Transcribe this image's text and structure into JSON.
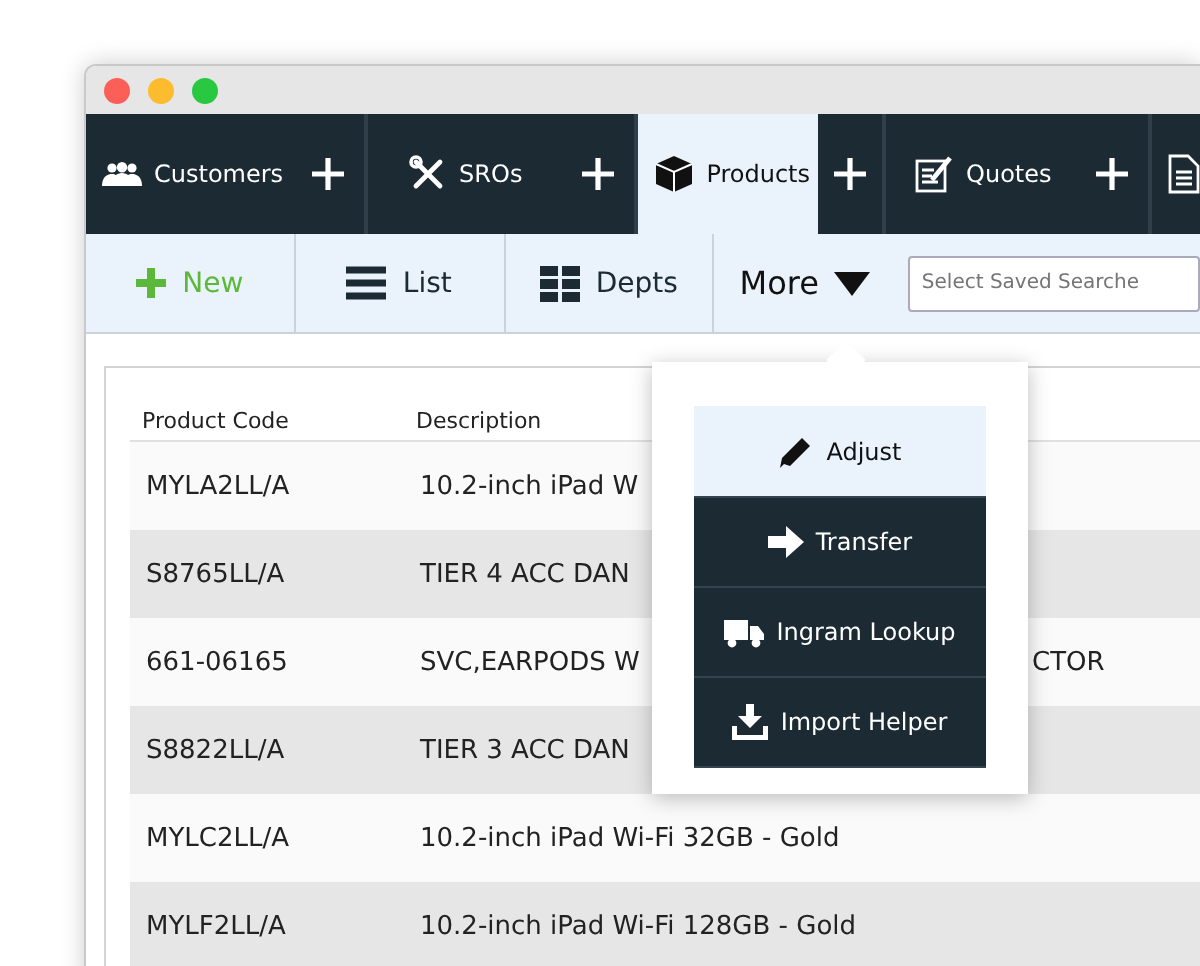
{
  "tabs": [
    {
      "label": "Customers",
      "selected": false
    },
    {
      "label": "SROs",
      "selected": false
    },
    {
      "label": "Products",
      "selected": true
    },
    {
      "label": "Quotes",
      "selected": false
    },
    {
      "selected": false
    }
  ],
  "toolbar": [
    {
      "label": "New",
      "kind": "primary"
    },
    {
      "label": "List",
      "kind": "list"
    },
    {
      "label": "Depts",
      "kind": "grid"
    },
    {
      "label": "More",
      "kind": "dropdown"
    }
  ],
  "search": {
    "placeholder": "Select Saved Searche"
  },
  "table": {
    "columns": [
      "Product Code",
      "Description"
    ],
    "rows": [
      {
        "code": "MYLA2LL/A",
        "description": "10.2-inch iPad W"
      },
      {
        "code": "S8765LL/A",
        "description": "TIER 4 ACC DAN"
      },
      {
        "code": "661-06165",
        "description": "SVC,EARPODS W",
        "column_3": "CTOR"
      },
      {
        "code": "S8822LL/A",
        "description": "TIER 3 ACC DAN"
      },
      {
        "code": "MYLC2LL/A",
        "description": "10.2-inch iPad Wi-Fi 32GB - Gold"
      },
      {
        "code": "MYLF2LL/A",
        "description": "10.2-inch iPad Wi-Fi 128GB - Gold"
      }
    ]
  },
  "more_menu": [
    {
      "label": "Adjust",
      "selected": true
    },
    {
      "label": "Transfer",
      "selected": false
    },
    {
      "label": "Ingram Lookup",
      "selected": false
    },
    {
      "label": "Import Helper",
      "selected": false
    }
  ]
}
